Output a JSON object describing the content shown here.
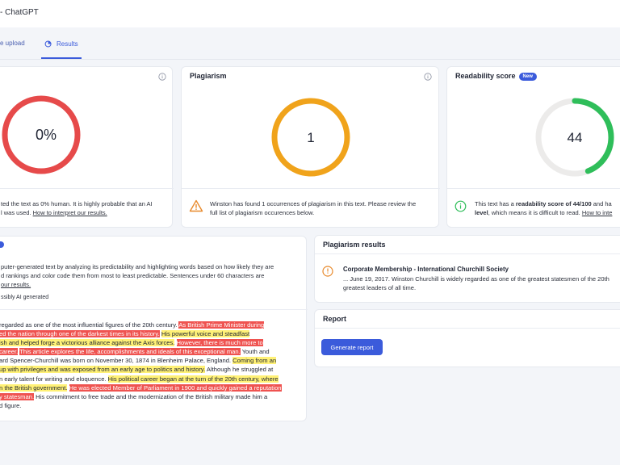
{
  "window": {
    "title": "- ChatGPT"
  },
  "tabs": [
    {
      "label": "e upload"
    },
    {
      "label": "Results"
    }
  ],
  "ai_card": {
    "score": "0%",
    "ring_color": "#e64a4a",
    "note_lines": [
      "ted the text as 0% human. It is highly probable that an AI",
      "l was used."
    ],
    "link": "How to interpret our results."
  },
  "plagiarism_card": {
    "title": "Plagiarism",
    "count": "1",
    "ring_color": "#f0a31b",
    "note_lines": [
      "Winston has found 1 occurrences of plagiarism in this text. Please review the",
      "full list of plagiarism occurences below."
    ]
  },
  "readability_card": {
    "title": "Readability score",
    "badge": "New",
    "score": "44",
    "score_fraction": 0.44,
    "ring_color": "#2fbe5a",
    "note_prefix": "This text has a ",
    "note_bold_1": "readability score of 44/100",
    "note_mid": " and ha",
    "note_bold_2": "level",
    "note_suffix": ", which means it is difficult to read.",
    "link": "How to inte"
  },
  "text_card": {
    "blurb_lines": [
      "puter-generated text by analyzing its predictability and highlighting words based on how likely they are",
      "d rankings and color code them from most to least predictable. Sentences under 60 characters are",
      "our results."
    ],
    "legend": "ssibly AI generated",
    "body": [
      [
        {
          "t": "regarded as one of the most influential figures of the 20th century. ",
          "c": ""
        },
        {
          "t": "As British Prime Minister during",
          "c": "red"
        }
      ],
      [
        {
          "t": "ed the nation through one of the darkest times in its history.",
          "c": "red"
        },
        {
          "t": " ",
          "c": ""
        },
        {
          "t": "His powerful voice and steadfast",
          "c": "yel"
        }
      ],
      [
        {
          "t": "ish and helped forge a victorious alliance against the Axis forces.",
          "c": "yel"
        },
        {
          "t": " ",
          "c": ""
        },
        {
          "t": "However, there is much more to",
          "c": "red"
        }
      ],
      [
        {
          "t": "career.",
          "c": "red"
        },
        {
          "t": " ",
          "c": ""
        },
        {
          "t": "This article explores the life, accomplishments and ideals of this exceptional man.",
          "c": "red"
        },
        {
          "t": " Youth and",
          "c": ""
        }
      ],
      [
        {
          "t": "ard Spencer-Churchill was born on November 30, 1874 in Blenheim Palace, England. ",
          "c": ""
        },
        {
          "t": "Coming from an",
          "c": "yel"
        }
      ],
      [
        {
          "t": " up with privileges and was exposed from an early age to politics and history.",
          "c": "yel"
        },
        {
          "t": " Although he struggled at",
          "c": ""
        }
      ],
      [
        {
          "t": "n early talent for writing and eloquence. ",
          "c": ""
        },
        {
          "t": "His political career began at the turn of the 20th century, where",
          "c": "yel"
        }
      ],
      [
        {
          "t": "n the British government.",
          "c": "yel"
        },
        {
          "t": " ",
          "c": ""
        },
        {
          "t": "He was elected Member of Parliament in 1900 and quickly gained a reputation",
          "c": "red"
        }
      ],
      [
        {
          "t": "y statesman.",
          "c": "red"
        },
        {
          "t": " His commitment to free trade and the modernization of the British military made him a",
          "c": ""
        }
      ],
      [
        {
          "t": "d figure.",
          "c": ""
        }
      ]
    ]
  },
  "plag_results": {
    "title": "Plagiarism results",
    "item_title": "Corporate Membership - International Churchill Society",
    "snippet_lines": [
      "... June 19, 2017. Winston Churchill is widely regarded as one of the greatest statesmen of the 20th",
      "greatest leaders of all time."
    ]
  },
  "report": {
    "title": "Report",
    "button": "Generate report"
  }
}
